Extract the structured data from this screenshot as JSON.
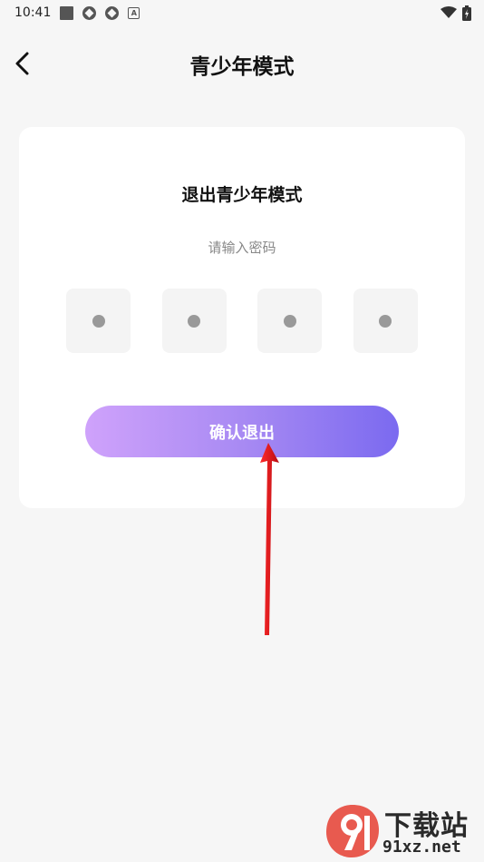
{
  "status_bar": {
    "time": "10:41",
    "icons": [
      "square-notification-icon",
      "app-notification-icon",
      "app-notification-icon-2",
      "a-notification-icon"
    ],
    "right_icons": [
      "wifi-icon",
      "battery-icon"
    ]
  },
  "header": {
    "title": "青少年模式",
    "back_icon": "chevron-left-icon"
  },
  "card": {
    "title": "退出青少年模式",
    "subtitle": "请输入密码",
    "pin_length": 4,
    "confirm_label": "确认退出"
  },
  "colors": {
    "background": "#f6f6f6",
    "card": "#ffffff",
    "button_gradient_start": "#cfa2fb",
    "button_gradient_end": "#7b6af0",
    "pin_box": "#f4f4f4",
    "pin_dot": "#999999",
    "annotation_arrow": "#e0141c"
  },
  "watermark": {
    "brand": "下载站",
    "domain": "91xz.net",
    "logo_text": "9"
  }
}
